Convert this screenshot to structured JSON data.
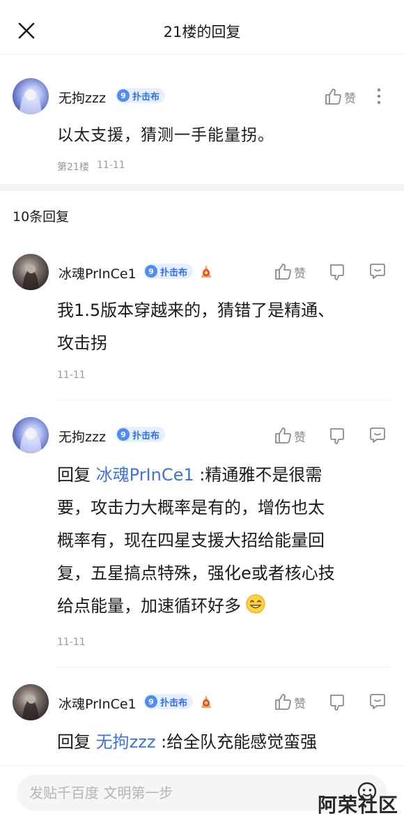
{
  "header": {
    "title": "21楼的回复"
  },
  "main_post": {
    "username": "无拘zzz",
    "badge_level": "9",
    "badge_label": "扑击布",
    "like_label": "赞",
    "content": "以太支援，猜测一手能量拐。",
    "floor": "第21楼",
    "date": "11-11"
  },
  "replies_header": {
    "count_label": "10条回复"
  },
  "replies": [
    {
      "username": "冰魂PrInCe1",
      "badge_level": "9",
      "badge_label": "扑击布",
      "like_label": "赞",
      "lines": [
        "我1.5版本穿越来的，猜错了是精通、",
        "攻击拐"
      ],
      "date": "11-11"
    },
    {
      "username": "无拘zzz",
      "badge_level": "9",
      "badge_label": "扑击布",
      "like_label": "赞",
      "reply_prefix": "回复",
      "mention": "冰魂PrInCe1",
      "line1_rest": ":精通雅不是很需",
      "lines": [
        "要，攻击力大概率是有的，增伤也太",
        "概率有，现在四星支援大招给能量回",
        "复，五星搞点特殊，强化e或者核心技",
        "给点能量，加速循环好多"
      ],
      "date": "11-11"
    },
    {
      "username": "冰魂PrInCe1",
      "badge_level": "9",
      "badge_label": "扑击布",
      "like_label": "赞",
      "reply_prefix": "回复",
      "mention": "无拘zzz",
      "line1_rest": ":给全队充能感觉蛮强"
    }
  ],
  "bottom_bar": {
    "input_placeholder": "发贴千百度 文明第一步"
  },
  "watermark": "阿荣社区"
}
